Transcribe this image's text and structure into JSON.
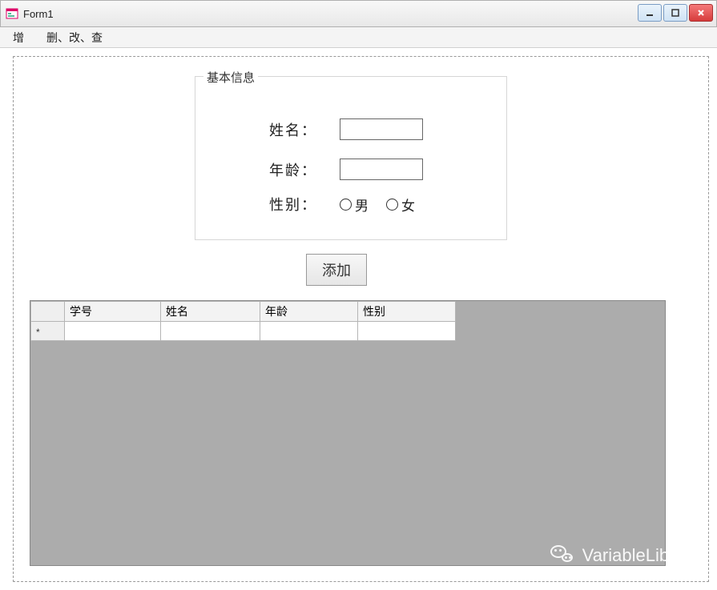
{
  "window": {
    "title": "Form1"
  },
  "menu": {
    "items": [
      {
        "label": "增"
      },
      {
        "label": "删、改、查"
      }
    ]
  },
  "groupbox": {
    "legend": "基本信息",
    "name_label": "姓名：",
    "age_label": "年龄：",
    "gender_label": "性别：",
    "name_value": "",
    "age_value": "",
    "gender_options": {
      "male": "男",
      "female": "女"
    }
  },
  "buttons": {
    "add": "添加"
  },
  "grid": {
    "columns": {
      "id": "学号",
      "name": "姓名",
      "age": "年龄",
      "gender": "性别"
    },
    "new_row_marker": "*"
  },
  "watermark": {
    "text": "VariableLibrary"
  }
}
